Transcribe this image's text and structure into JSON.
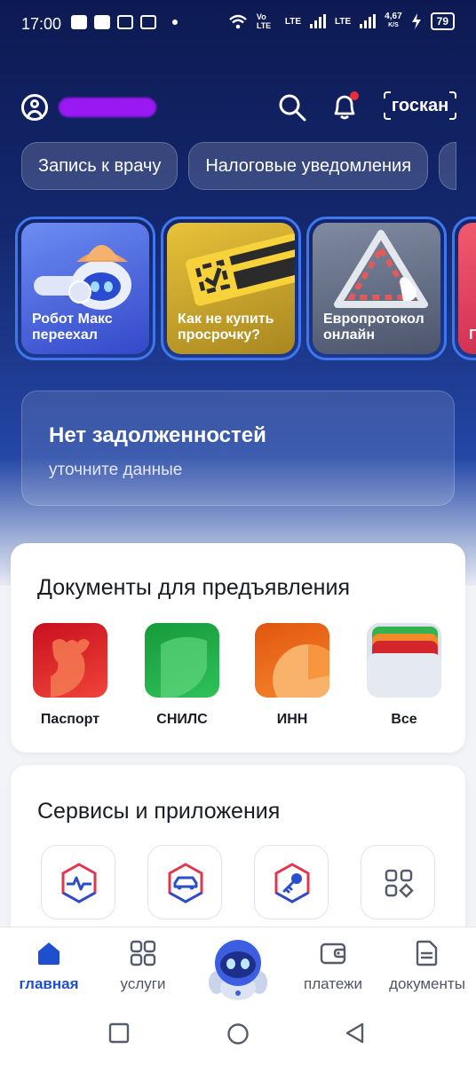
{
  "status_bar": {
    "time": "17:00",
    "network_speed": "4,67",
    "network_unit": "K/S",
    "battery": "79",
    "lte1": "LTE",
    "lte2": "LTE",
    "volte": "Vo LTE"
  },
  "header": {
    "profile_icon": "profile-icon",
    "search_icon": "search-icon",
    "notifications_icon": "bell-icon",
    "scan_label": "госкан"
  },
  "chips": [
    {
      "label": "Запись к врачу"
    },
    {
      "label": "Налоговые уведомления"
    }
  ],
  "stories": [
    {
      "label": "Робот Макс переехал",
      "color": "#4f6ae0"
    },
    {
      "label": "Как не купить просрочку?",
      "color": "#d1a82c"
    },
    {
      "label": "Европротокол онлайн",
      "color": "#5c667d"
    },
    {
      "label": "Г с",
      "color": "#e53a5c"
    }
  ],
  "debt": {
    "title": "Нет задолженностей",
    "subtitle": "уточните данные"
  },
  "documents": {
    "title": "Документы для предъявления",
    "items": [
      {
        "label": "Паспорт",
        "color": "#d4251f"
      },
      {
        "label": "СНИЛС",
        "color": "#22a645"
      },
      {
        "label": "ИНН",
        "color": "#ee6b1a"
      },
      {
        "label": "Все",
        "color": "#dde3ee"
      }
    ]
  },
  "services": {
    "title": "Сервисы и приложения",
    "items": [
      {
        "icon": "health-pulse-icon"
      },
      {
        "icon": "car-icon"
      },
      {
        "icon": "key-icon"
      },
      {
        "icon": "apps-grid-icon"
      }
    ]
  },
  "bottom_nav": [
    {
      "label": "главная",
      "icon": "home-icon",
      "active": true
    },
    {
      "label": "услуги",
      "icon": "services-grid-icon"
    },
    {
      "label": "",
      "icon": "robot-assistant-icon"
    },
    {
      "label": "платежи",
      "icon": "wallet-icon"
    },
    {
      "label": "документы",
      "icon": "document-icon"
    }
  ],
  "accent_color": "#1f4fd1"
}
